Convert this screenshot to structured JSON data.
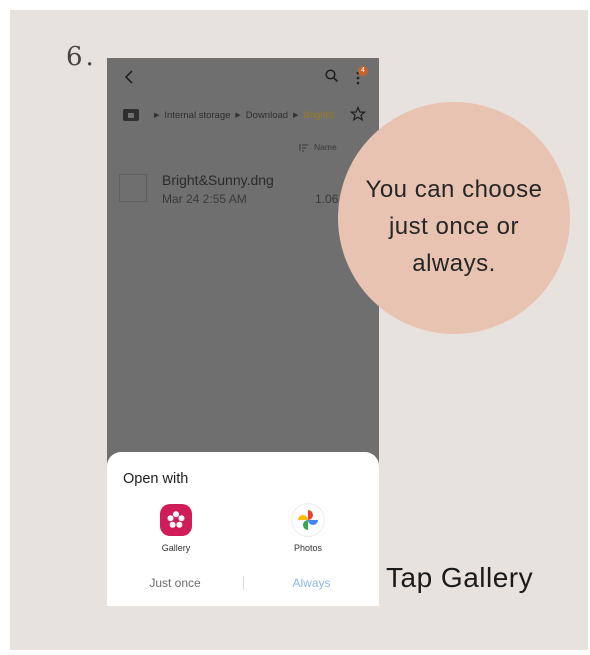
{
  "step_number": "6.",
  "phone": {
    "notification_count": "4",
    "breadcrumb": {
      "items": [
        "Internal storage",
        "Download",
        "BrightS"
      ]
    },
    "sort_label": "Name",
    "file": {
      "name": "Bright&Sunny.dng",
      "date": "Mar 24 2:55 AM",
      "size": "1.06"
    },
    "sheet": {
      "title": "Open with",
      "apps": [
        {
          "label": "Gallery",
          "icon": "gallery-icon"
        },
        {
          "label": "Photos",
          "icon": "photos-icon"
        }
      ],
      "actions": {
        "just_once": "Just once",
        "always": "Always"
      }
    }
  },
  "callout": {
    "lines": [
      "You can choose",
      "just once or",
      "always."
    ]
  },
  "caption": "Tap Gallery",
  "colors": {
    "background": "#e8e2de",
    "callout": "#e8c3b2",
    "dim_overlay": "#6f6f6f",
    "gallery": "#d01d5a",
    "always_action": "#8fb8e6"
  }
}
